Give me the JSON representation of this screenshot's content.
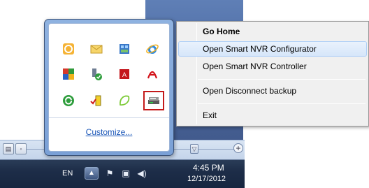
{
  "tray": {
    "customize_link": "Customize...",
    "icons": [
      "norton-icon",
      "mail-icon",
      "app-grid-icon",
      "ie-icon",
      "color-squares-icon",
      "shield-check-icon",
      "acrobat-icon",
      "pdf-reader-icon",
      "sync-icon",
      "battery-check-icon",
      "leaf-outline-icon",
      "smart-nvr-icon"
    ],
    "selected_icon": "smart-nvr-icon",
    "highlight_color": "#c41a1a"
  },
  "menu": {
    "items": [
      {
        "label": "Go Home",
        "bold": true
      },
      {
        "label": "Open Smart NVR Configurator",
        "hovered": true
      },
      {
        "label": "Open Smart NVR Controller"
      },
      {
        "label": "Open Disconnect backup"
      },
      {
        "label": "Exit"
      }
    ]
  },
  "taskbar": {
    "language": "EN",
    "show_hidden_glyph": "▲",
    "time": "4:45 PM",
    "date": "12/17/2012",
    "icons": [
      "flag-icon",
      "network-icon",
      "volume-icon"
    ]
  }
}
